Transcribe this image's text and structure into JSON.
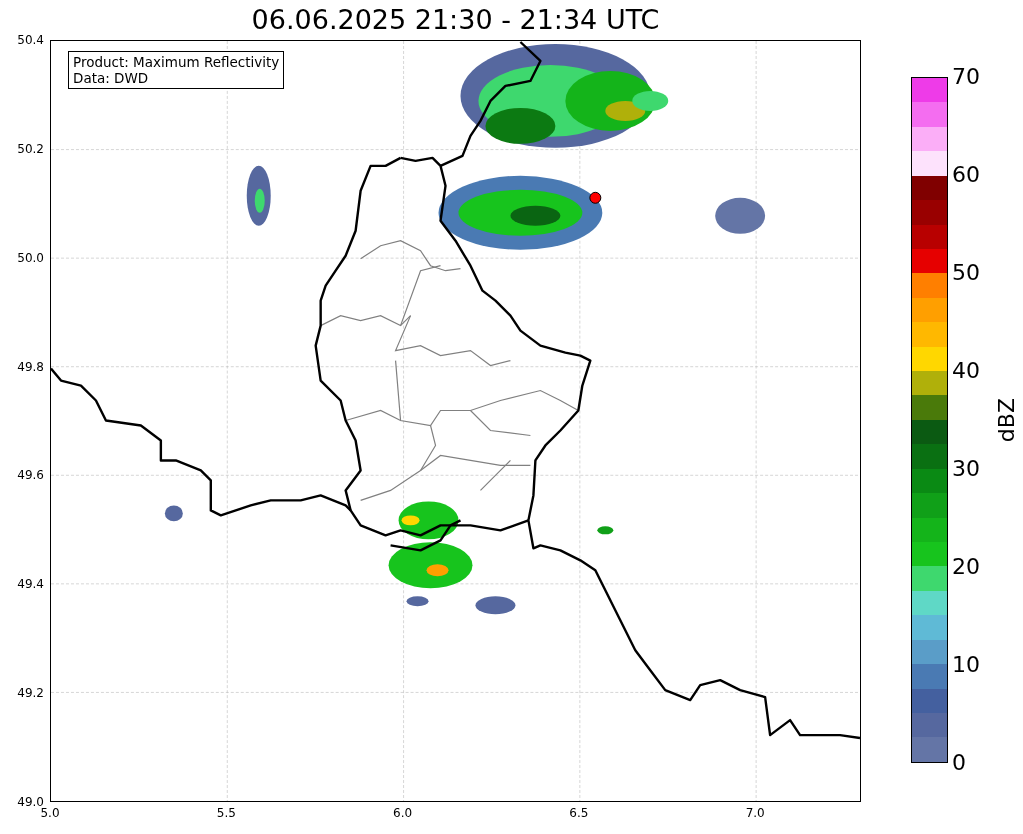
{
  "title": "06.06.2025 21:30 - 21:34 UTC",
  "map": {
    "info_box": [
      "Product: Maximum Reflectivity",
      "Data: DWD"
    ],
    "y_ticks": [
      "50.4",
      "50.2",
      "50.0",
      "49.8",
      "49.6",
      "49.4",
      "49.2",
      "49.0"
    ],
    "x_ticks": [
      "5.0",
      "5.5",
      "6.0",
      "6.5",
      "7.0"
    ]
  },
  "colorbar": {
    "label": "dBZ",
    "ticks": [
      "70",
      "60",
      "50",
      "40",
      "30",
      "20",
      "10",
      "0"
    ],
    "segments": [
      {
        "color": "#ee3be8"
      },
      {
        "color": "#f46df0"
      },
      {
        "color": "#fbaef7"
      },
      {
        "color": "#fde2fc"
      },
      {
        "color": "#800000"
      },
      {
        "color": "#990000"
      },
      {
        "color": "#b80000"
      },
      {
        "color": "#e60000"
      },
      {
        "color": "#ff7f00"
      },
      {
        "color": "#ff9f00"
      },
      {
        "color": "#ffb800"
      },
      {
        "color": "#ffd700"
      },
      {
        "color": "#b0b00a"
      },
      {
        "color": "#4a7a0a"
      },
      {
        "color": "#0b5a12"
      },
      {
        "color": "#0a7012"
      },
      {
        "color": "#0a8a14"
      },
      {
        "color": "#10a018"
      },
      {
        "color": "#14b41a"
      },
      {
        "color": "#17c41d"
      },
      {
        "color": "#3ed86e"
      },
      {
        "color": "#5fd8c6"
      },
      {
        "color": "#5fbad6"
      },
      {
        "color": "#5a9dc8"
      },
      {
        "color": "#4a7ab3"
      },
      {
        "color": "#44609f"
      },
      {
        "color": "#56689f"
      },
      {
        "color": "#6475a6"
      }
    ]
  }
}
